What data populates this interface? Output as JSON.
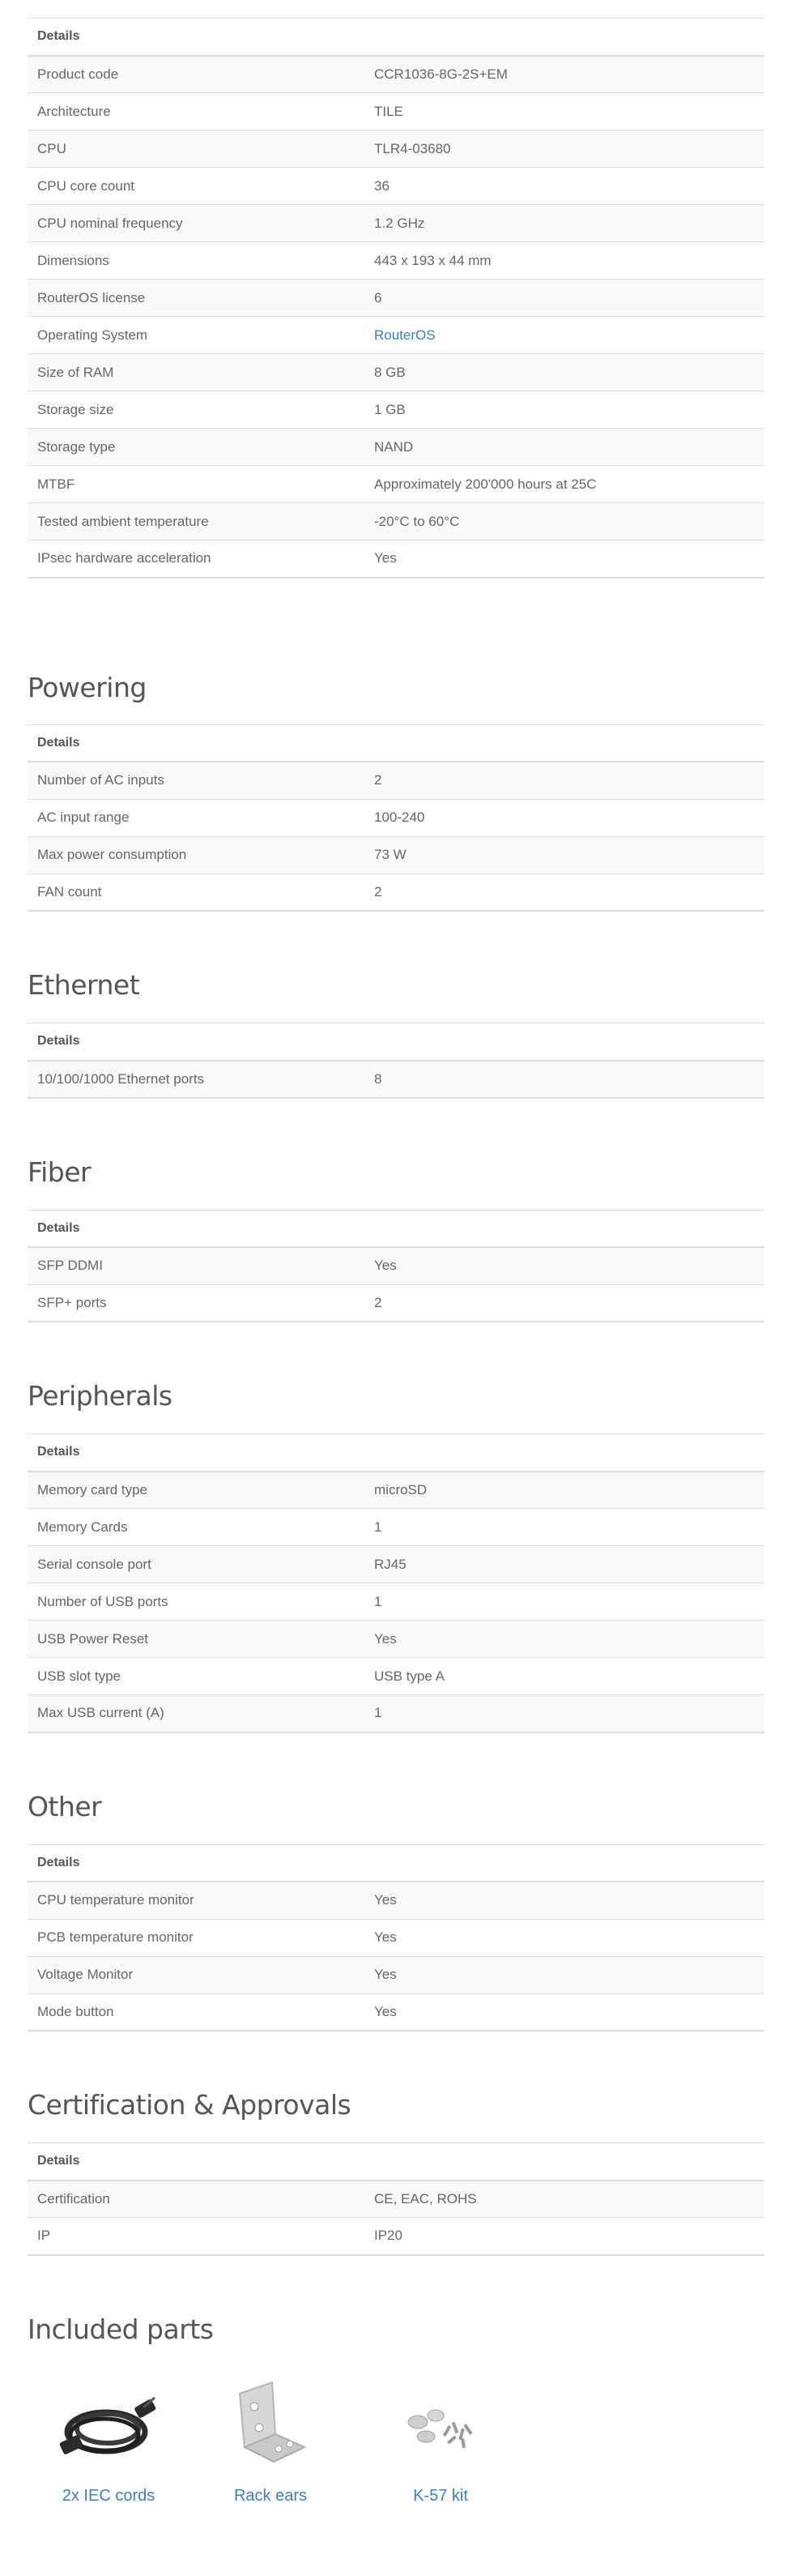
{
  "details_header": "Details",
  "general": {
    "rows": [
      {
        "key": "Product code",
        "value": "CCR1036-8G-2S+EM"
      },
      {
        "key": "Architecture",
        "value": "TILE"
      },
      {
        "key": "CPU",
        "value": "TLR4-03680"
      },
      {
        "key": "CPU core count",
        "value": "36"
      },
      {
        "key": "CPU nominal frequency",
        "value": "1.2 GHz"
      },
      {
        "key": "Dimensions",
        "value": "443 x 193 x 44 mm"
      },
      {
        "key": "RouterOS license",
        "value": "6"
      },
      {
        "key": "Operating System",
        "value": "RouterOS"
      },
      {
        "key": "Size of RAM",
        "value": "8 GB"
      },
      {
        "key": "Storage size",
        "value": "1 GB"
      },
      {
        "key": "Storage type",
        "value": "NAND"
      },
      {
        "key": "MTBF",
        "value": "Approximately 200'000 hours at 25C"
      },
      {
        "key": "Tested ambient temperature",
        "value": "-20°C to 60°C"
      },
      {
        "key": "IPsec hardware acceleration",
        "value": "Yes"
      }
    ]
  },
  "powering": {
    "title": "Powering",
    "rows": [
      {
        "key": "Number of AC inputs",
        "value": "2"
      },
      {
        "key": "AC input range",
        "value": "100-240"
      },
      {
        "key": "Max power consumption",
        "value": "73 W"
      },
      {
        "key": "FAN count",
        "value": "2"
      }
    ]
  },
  "ethernet": {
    "title": "Ethernet",
    "rows": [
      {
        "key": "10/100/1000 Ethernet ports",
        "value": "8"
      }
    ]
  },
  "fiber": {
    "title": "Fiber",
    "rows": [
      {
        "key": "SFP DDMI",
        "value": "Yes"
      },
      {
        "key": "SFP+ ports",
        "value": "2"
      }
    ]
  },
  "peripherals": {
    "title": "Peripherals",
    "rows": [
      {
        "key": "Memory card type",
        "value": "microSD"
      },
      {
        "key": "Memory Cards",
        "value": "1"
      },
      {
        "key": "Serial console port",
        "value": "RJ45"
      },
      {
        "key": "Number of USB ports",
        "value": "1"
      },
      {
        "key": "USB Power Reset",
        "value": "Yes"
      },
      {
        "key": "USB slot type",
        "value": "USB type A"
      },
      {
        "key": "Max USB current (A)",
        "value": "1"
      }
    ]
  },
  "other": {
    "title": "Other",
    "rows": [
      {
        "key": "CPU temperature monitor",
        "value": "Yes"
      },
      {
        "key": "PCB temperature monitor",
        "value": "Yes"
      },
      {
        "key": "Voltage Monitor",
        "value": "Yes"
      },
      {
        "key": "Mode button",
        "value": "Yes"
      }
    ]
  },
  "certification": {
    "title": "Certification & Approvals",
    "rows": [
      {
        "key": "Certification",
        "value": "CE, EAC, ROHS"
      },
      {
        "key": "IP",
        "value": "IP20"
      }
    ]
  },
  "included_parts": {
    "title": "Included parts",
    "items": [
      {
        "label": "2x IEC cords",
        "icon": "power-cord-icon"
      },
      {
        "label": "Rack ears",
        "icon": "rack-ear-icon"
      },
      {
        "label": "K-57 kit",
        "icon": "screw-kit-icon"
      }
    ]
  },
  "colors": {
    "link": "#3f7fb5",
    "border": "#dddddd",
    "stripe": "#f9f9f9"
  }
}
